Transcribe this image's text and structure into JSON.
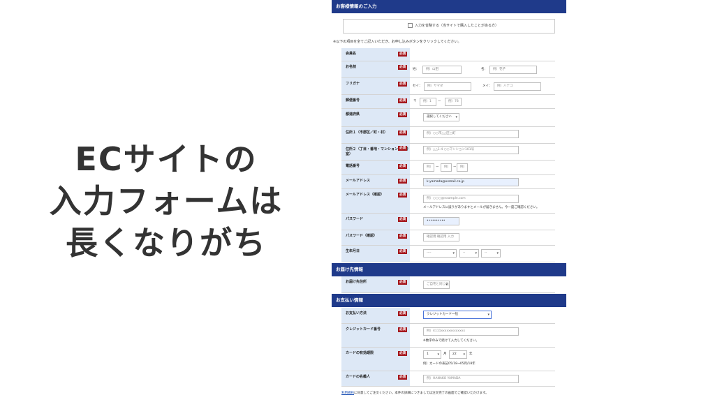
{
  "headline": [
    "ECサイトの",
    "入力フォームは",
    "長くなりがち"
  ],
  "form": {
    "customer_header": "お客様情報のご入力",
    "reuse_option": "入力を省略する（当サイトで購入したことがある方）",
    "intro_note": "※以下の項目を全てご記入いただき、お申し込みボタンをクリックしてください。",
    "required": "必須",
    "rows": [
      {
        "label": "会員名"
      },
      {
        "label": "お名前",
        "sei": "姓：",
        "mei": "名：",
        "sei_ph": "例）山田",
        "mei_ph": "例）花子"
      },
      {
        "label": "フリガナ",
        "sei": "セイ：",
        "mei": "メイ：",
        "sei_ph": "例）ヤマダ",
        "mei_ph": "例）ハナコ"
      },
      {
        "label": "郵便番号",
        "mark": "〒",
        "z1_ph": "例）1",
        "z2_ph": "例）78",
        "dash": "ー"
      },
      {
        "label": "都道府県",
        "select": "選択してください"
      },
      {
        "label": "住所１（市郡区／町・村）",
        "ph": "例）○○市△△区□町"
      },
      {
        "label": "住所２（丁目・番地・マンション名・号室）",
        "ph": "例）△△1-4 ○○マンション101号"
      },
      {
        "label": "電話番号",
        "t1_ph": "例）",
        "t2_ph": "例）",
        "t3_ph": "例）",
        "dash": "ー"
      },
      {
        "label": "メールアドレス",
        "value": "k.yamada@xxmail.co.jp"
      },
      {
        "label": "メールアドレス（確認）",
        "ph": "例）○○○@example.com",
        "note": "メールアドレスに誤りがありますとメールが届きません。今一度ご確認ください。"
      },
      {
        "label": "パスワード",
        "value": "••••••••••"
      },
      {
        "label": "パスワード（確認）",
        "ph": "確認用 確認用 入力"
      },
      {
        "label": "生年月日",
        "y": "----",
        "m": "--",
        "d": "--"
      }
    ],
    "delivery_header": "お届け先情報",
    "delivery_label": "お届け先住所",
    "delivery_select": "ご自宅と同じ住所",
    "payment_header": "お支払い情報",
    "payment_rows": [
      {
        "label": "お支払い方法",
        "select": "クレジットカード一括"
      },
      {
        "label": "クレジットカード番号",
        "ph": "例）4111xxxxxxxxxxxxx",
        "note": "※数字のみで続けて入力してください。"
      },
      {
        "label": "カードの有効期限",
        "month": "1",
        "month_unit": "月",
        "year": "22",
        "year_unit": "年",
        "note": "例）カードの表記05/18→05月/18年"
      },
      {
        "label": "カードの名義人",
        "ph": "例）HANAKO YAMADA"
      }
    ],
    "footer_link": "利用規約",
    "footer_text": "に同意してご注文ください。本件の詳細につきましては注文完了の画面でご確認いただけます。",
    "colors": {
      "header_bg": "#1f3a8a",
      "label_bg": "#dde8f6",
      "required_bg": "#a5161c"
    }
  }
}
